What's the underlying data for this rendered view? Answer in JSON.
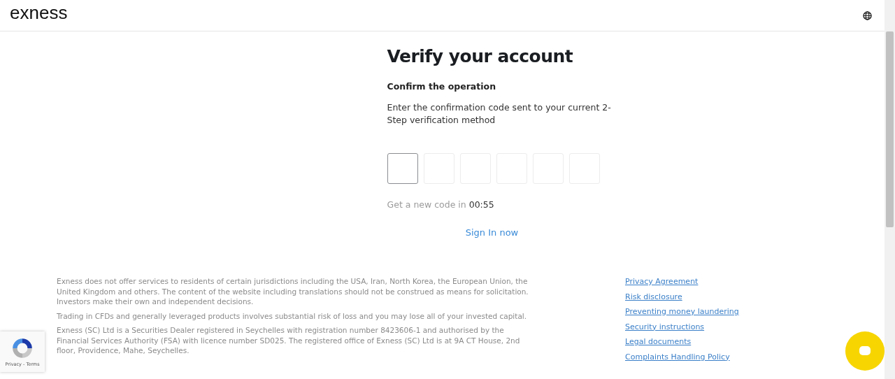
{
  "header": {
    "logo": "exness"
  },
  "verify": {
    "title": "Verify your account",
    "subtitle": "Confirm the operation",
    "instructions": "Enter the confirmation code sent to your current 2-Step verification method",
    "code_boxes": [
      {
        "focused": true
      },
      {
        "focused": false
      },
      {
        "focused": false
      },
      {
        "focused": false
      },
      {
        "focused": false
      },
      {
        "focused": false
      }
    ],
    "resend_text": "Get a new code in",
    "timer": "00:55",
    "sign_in_link": "Sign In now"
  },
  "footer": {
    "disclaimers": [
      "Exness does not offer services to residents of certain jurisdictions including the USA, Iran, North Korea, the European Union, the United Kingdom and others. The content of the website including translations should not be construed as means for solicitation. Investors make their own and independent decisions.",
      "Trading in CFDs and generally leveraged products involves substantial risk of loss and you may lose all of your invested capital.",
      "Exness (SC) Ltd is a Securities Dealer registered in Seychelles with registration number 8423606-1 and authorised by the Financial Services Authority (FSA) with licence number SD025. The registered office of Exness (SC) Ltd is at 9A CT House, 2nd floor, Providence, Mahe, Seychelles."
    ],
    "links": [
      "Privacy Agreement",
      "Risk disclosure",
      "Preventing money laundering",
      "Security instructions",
      "Legal documents",
      "Complaints Handling Policy"
    ]
  },
  "recaptcha": {
    "label": "Privacy - Terms"
  }
}
